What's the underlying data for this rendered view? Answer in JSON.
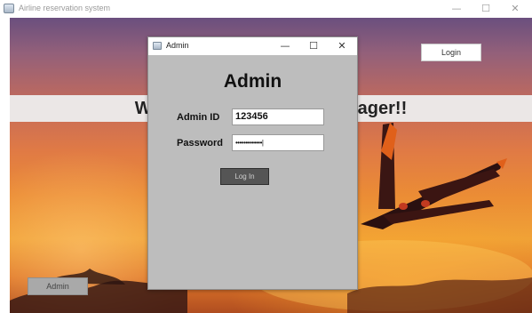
{
  "main_window": {
    "title": "Airline reservation system",
    "icon": "java-window-icon",
    "controls": {
      "minimize": "—",
      "maximize": "☐",
      "close": "✕"
    }
  },
  "header": {
    "login_label": "Login"
  },
  "welcome": {
    "prefix": "W",
    "suffix": "ager!!"
  },
  "footer": {
    "admin_label": "Admin"
  },
  "dialog": {
    "title": "Admin",
    "icon": "java-window-icon",
    "controls": {
      "minimize": "—",
      "maximize": "☐",
      "close": "✕"
    },
    "heading": "Admin",
    "admin_id_label": "Admin ID",
    "admin_id_value": "123456",
    "password_label": "Password",
    "password_value": "•••••••••••••|",
    "submit_label": "Log In"
  }
}
